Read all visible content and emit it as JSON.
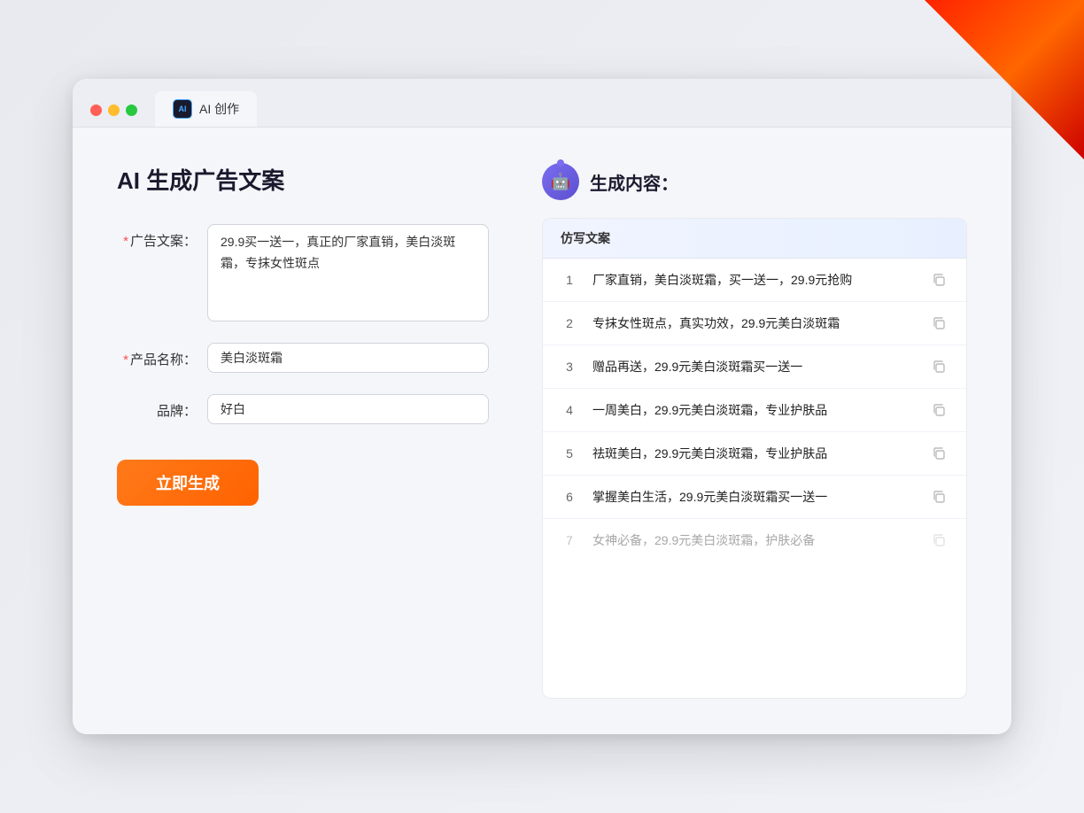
{
  "window": {
    "tab_label": "AI 创作",
    "ai_icon_text": "AI"
  },
  "page": {
    "title": "AI 生成广告文案"
  },
  "form": {
    "ad_copy_label": "广告文案：",
    "ad_copy_required": "*",
    "ad_copy_value": "29.9买一送一，真正的厂家直销，美白淡斑霜，专抹女性斑点",
    "product_name_label": "产品名称：",
    "product_name_required": "*",
    "product_name_value": "美白淡斑霜",
    "brand_label": "品牌：",
    "brand_value": "好白",
    "submit_label": "立即生成"
  },
  "output": {
    "title": "生成内容：",
    "column_header": "仿写文案",
    "results": [
      {
        "num": "1",
        "text": "厂家直销，美白淡斑霜，买一送一，29.9元抢购",
        "faded": false
      },
      {
        "num": "2",
        "text": "专抹女性斑点，真实功效，29.9元美白淡斑霜",
        "faded": false
      },
      {
        "num": "3",
        "text": "赠品再送，29.9元美白淡斑霜买一送一",
        "faded": false
      },
      {
        "num": "4",
        "text": "一周美白，29.9元美白淡斑霜，专业护肤品",
        "faded": false
      },
      {
        "num": "5",
        "text": "祛斑美白，29.9元美白淡斑霜，专业护肤品",
        "faded": false
      },
      {
        "num": "6",
        "text": "掌握美白生活，29.9元美白淡斑霜买一送一",
        "faded": false
      },
      {
        "num": "7",
        "text": "女神必备，29.9元美白淡斑霜，护肤必备",
        "faded": true
      }
    ]
  }
}
